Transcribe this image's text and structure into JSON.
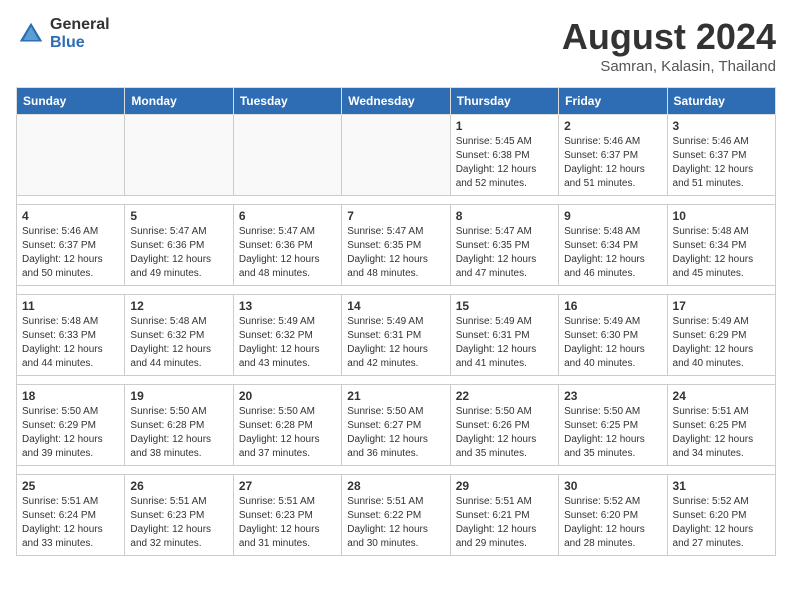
{
  "logo": {
    "general": "General",
    "blue": "Blue"
  },
  "header": {
    "month_year": "August 2024",
    "location": "Samran, Kalasin, Thailand"
  },
  "weekdays": [
    "Sunday",
    "Monday",
    "Tuesday",
    "Wednesday",
    "Thursday",
    "Friday",
    "Saturday"
  ],
  "weeks": [
    [
      {
        "day": "",
        "info": ""
      },
      {
        "day": "",
        "info": ""
      },
      {
        "day": "",
        "info": ""
      },
      {
        "day": "",
        "info": ""
      },
      {
        "day": "1",
        "info": "Sunrise: 5:45 AM\nSunset: 6:38 PM\nDaylight: 12 hours and 52 minutes."
      },
      {
        "day": "2",
        "info": "Sunrise: 5:46 AM\nSunset: 6:37 PM\nDaylight: 12 hours and 51 minutes."
      },
      {
        "day": "3",
        "info": "Sunrise: 5:46 AM\nSunset: 6:37 PM\nDaylight: 12 hours and 51 minutes."
      }
    ],
    [
      {
        "day": "4",
        "info": "Sunrise: 5:46 AM\nSunset: 6:37 PM\nDaylight: 12 hours and 50 minutes."
      },
      {
        "day": "5",
        "info": "Sunrise: 5:47 AM\nSunset: 6:36 PM\nDaylight: 12 hours and 49 minutes."
      },
      {
        "day": "6",
        "info": "Sunrise: 5:47 AM\nSunset: 6:36 PM\nDaylight: 12 hours and 48 minutes."
      },
      {
        "day": "7",
        "info": "Sunrise: 5:47 AM\nSunset: 6:35 PM\nDaylight: 12 hours and 48 minutes."
      },
      {
        "day": "8",
        "info": "Sunrise: 5:47 AM\nSunset: 6:35 PM\nDaylight: 12 hours and 47 minutes."
      },
      {
        "day": "9",
        "info": "Sunrise: 5:48 AM\nSunset: 6:34 PM\nDaylight: 12 hours and 46 minutes."
      },
      {
        "day": "10",
        "info": "Sunrise: 5:48 AM\nSunset: 6:34 PM\nDaylight: 12 hours and 45 minutes."
      }
    ],
    [
      {
        "day": "11",
        "info": "Sunrise: 5:48 AM\nSunset: 6:33 PM\nDaylight: 12 hours and 44 minutes."
      },
      {
        "day": "12",
        "info": "Sunrise: 5:48 AM\nSunset: 6:32 PM\nDaylight: 12 hours and 44 minutes."
      },
      {
        "day": "13",
        "info": "Sunrise: 5:49 AM\nSunset: 6:32 PM\nDaylight: 12 hours and 43 minutes."
      },
      {
        "day": "14",
        "info": "Sunrise: 5:49 AM\nSunset: 6:31 PM\nDaylight: 12 hours and 42 minutes."
      },
      {
        "day": "15",
        "info": "Sunrise: 5:49 AM\nSunset: 6:31 PM\nDaylight: 12 hours and 41 minutes."
      },
      {
        "day": "16",
        "info": "Sunrise: 5:49 AM\nSunset: 6:30 PM\nDaylight: 12 hours and 40 minutes."
      },
      {
        "day": "17",
        "info": "Sunrise: 5:49 AM\nSunset: 6:29 PM\nDaylight: 12 hours and 40 minutes."
      }
    ],
    [
      {
        "day": "18",
        "info": "Sunrise: 5:50 AM\nSunset: 6:29 PM\nDaylight: 12 hours and 39 minutes."
      },
      {
        "day": "19",
        "info": "Sunrise: 5:50 AM\nSunset: 6:28 PM\nDaylight: 12 hours and 38 minutes."
      },
      {
        "day": "20",
        "info": "Sunrise: 5:50 AM\nSunset: 6:28 PM\nDaylight: 12 hours and 37 minutes."
      },
      {
        "day": "21",
        "info": "Sunrise: 5:50 AM\nSunset: 6:27 PM\nDaylight: 12 hours and 36 minutes."
      },
      {
        "day": "22",
        "info": "Sunrise: 5:50 AM\nSunset: 6:26 PM\nDaylight: 12 hours and 35 minutes."
      },
      {
        "day": "23",
        "info": "Sunrise: 5:50 AM\nSunset: 6:25 PM\nDaylight: 12 hours and 35 minutes."
      },
      {
        "day": "24",
        "info": "Sunrise: 5:51 AM\nSunset: 6:25 PM\nDaylight: 12 hours and 34 minutes."
      }
    ],
    [
      {
        "day": "25",
        "info": "Sunrise: 5:51 AM\nSunset: 6:24 PM\nDaylight: 12 hours and 33 minutes."
      },
      {
        "day": "26",
        "info": "Sunrise: 5:51 AM\nSunset: 6:23 PM\nDaylight: 12 hours and 32 minutes."
      },
      {
        "day": "27",
        "info": "Sunrise: 5:51 AM\nSunset: 6:23 PM\nDaylight: 12 hours and 31 minutes."
      },
      {
        "day": "28",
        "info": "Sunrise: 5:51 AM\nSunset: 6:22 PM\nDaylight: 12 hours and 30 minutes."
      },
      {
        "day": "29",
        "info": "Sunrise: 5:51 AM\nSunset: 6:21 PM\nDaylight: 12 hours and 29 minutes."
      },
      {
        "day": "30",
        "info": "Sunrise: 5:52 AM\nSunset: 6:20 PM\nDaylight: 12 hours and 28 minutes."
      },
      {
        "day": "31",
        "info": "Sunrise: 5:52 AM\nSunset: 6:20 PM\nDaylight: 12 hours and 27 minutes."
      }
    ]
  ]
}
